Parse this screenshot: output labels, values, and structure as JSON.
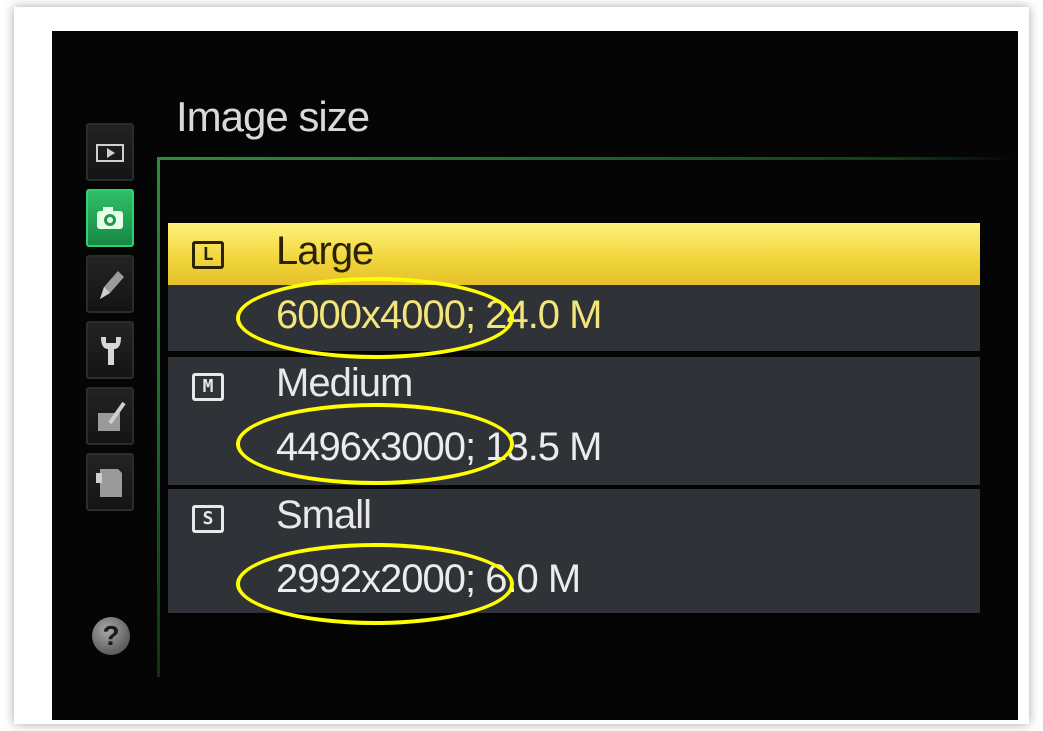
{
  "menu": {
    "title": "Image size",
    "tabs": [
      {
        "name": "playback-menu",
        "icon": "play-icon",
        "active": false
      },
      {
        "name": "shooting-menu",
        "icon": "camera-icon",
        "active": true
      },
      {
        "name": "retouch-menu",
        "icon": "pencil-icon",
        "active": false
      },
      {
        "name": "setup-menu",
        "icon": "wrench-icon",
        "active": false
      },
      {
        "name": "custom-menu",
        "icon": "edit-icon",
        "active": false
      },
      {
        "name": "recent-settings-menu",
        "icon": "document-icon",
        "active": false
      }
    ],
    "help_label": "?"
  },
  "options": [
    {
      "icon_letter": "L",
      "label": "Large",
      "value": "6000x4000; 24.0 M",
      "selected": true
    },
    {
      "icon_letter": "M",
      "label": "Medium",
      "value": "4496x3000; 13.5 M",
      "selected": false
    },
    {
      "icon_letter": "S",
      "label": "Small",
      "value": "2992x2000; 6.0 M",
      "selected": false
    }
  ],
  "colors": {
    "highlight": "#f0d43a",
    "annotation": "#ffff00",
    "active_tab": "#2fbf68",
    "row_bg": "#2f3236"
  }
}
